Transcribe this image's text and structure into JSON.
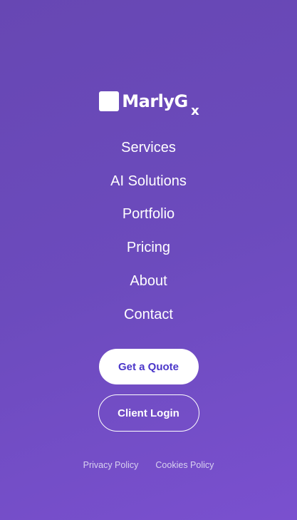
{
  "brand": {
    "name": "MarlyG",
    "mark": "x"
  },
  "nav": {
    "items": [
      {
        "label": "Services"
      },
      {
        "label": "AI Solutions"
      },
      {
        "label": "Portfolio"
      },
      {
        "label": "Pricing"
      },
      {
        "label": "About"
      },
      {
        "label": "Contact"
      }
    ]
  },
  "cta": {
    "quote_label": "Get a Quote",
    "login_label": "Client Login"
  },
  "footer": {
    "privacy_label": "Privacy Policy",
    "cookies_label": "Cookies Policy"
  },
  "colors": {
    "background_start": "#6747b3",
    "background_end": "#7a50cf",
    "accent": "#4a36c9",
    "text": "#ffffff"
  }
}
